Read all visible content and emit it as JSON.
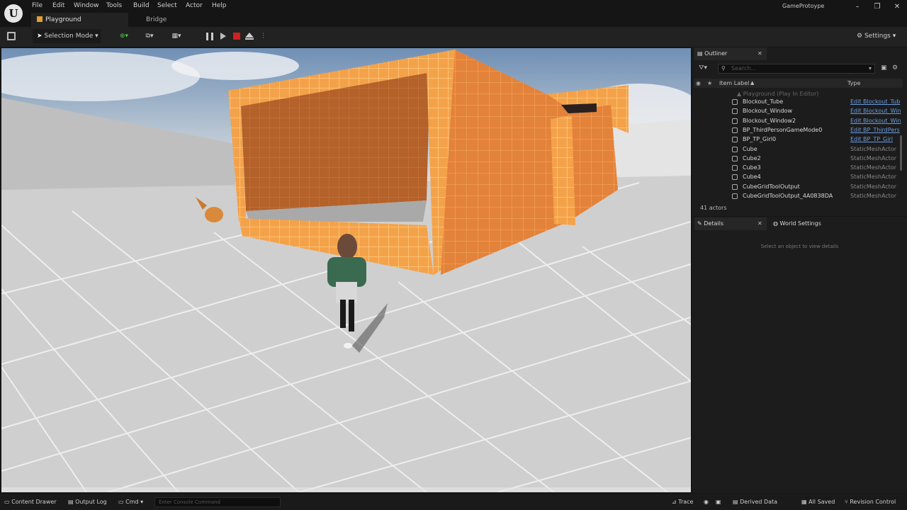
{
  "window": {
    "project_name": "GameProtoype",
    "minimize": "–",
    "maximize": "❐",
    "close": "✕"
  },
  "menu": [
    "File",
    "Edit",
    "Window",
    "Tools",
    "Build",
    "Select",
    "Actor",
    "Help"
  ],
  "tabs": {
    "active": "Playground",
    "second": "Bridge"
  },
  "toolbar": {
    "mode_label": "Selection Mode",
    "settings_label": "Settings"
  },
  "outliner": {
    "tab_label": "Outliner",
    "search_placeholder": "Search...",
    "col_label": "Item Label",
    "col_type": "Type",
    "world_row": "Playground (Play In Editor)",
    "rows": [
      {
        "label": "Blockout_Tube",
        "type": "Edit Blockout_Tub",
        "link": true
      },
      {
        "label": "Blockout_Window",
        "type": "Edit Blockout_Win",
        "link": true
      },
      {
        "label": "Blockout_Window2",
        "type": "Edit Blockout_Win",
        "link": true
      },
      {
        "label": "BP_ThirdPersonGameMode0",
        "type": "Edit BP_ThirdPers",
        "link": true
      },
      {
        "label": "BP_TP_Girl0",
        "type": "Edit BP_TP_Girl",
        "link": true
      },
      {
        "label": "Cube",
        "type": "StaticMeshActor",
        "link": false
      },
      {
        "label": "Cube2",
        "type": "StaticMeshActor",
        "link": false
      },
      {
        "label": "Cube3",
        "type": "StaticMeshActor",
        "link": false
      },
      {
        "label": "Cube4",
        "type": "StaticMeshActor",
        "link": false
      },
      {
        "label": "CubeGridToolOutput",
        "type": "StaticMeshActor",
        "link": false
      },
      {
        "label": "CubeGridToolOutput_4A0838DA",
        "type": "StaticMeshActor",
        "link": false
      }
    ],
    "actor_count": "41 actors"
  },
  "details": {
    "tab_label": "Details",
    "world_settings_label": "World Settings",
    "empty_message": "Select an object to view details"
  },
  "statusbar": {
    "content_drawer": "Content Drawer",
    "output_log": "Output Log",
    "cmd": "Cmd",
    "console_placeholder": "Enter Console Command",
    "trace": "Trace",
    "derived_data": "Derived Data",
    "all_saved": "All Saved",
    "revision_control": "Revision Control"
  },
  "colors": {
    "accent_play_tab": "#e0a030",
    "stop_red": "#d02020",
    "brick_orange": "#f09a40",
    "link_blue": "#6a9be0"
  }
}
